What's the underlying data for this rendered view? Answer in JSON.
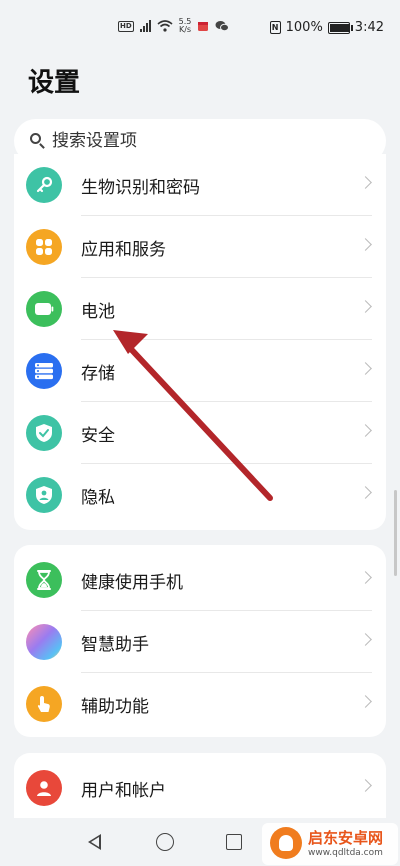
{
  "status_bar": {
    "speed_value": "5.5",
    "speed_unit": "K/s",
    "battery": "100%",
    "battery_level": 1.0,
    "time": "3:42",
    "hd": "HD",
    "nfc": "N"
  },
  "page": {
    "title": "设置"
  },
  "search": {
    "placeholder": "搜索设置项"
  },
  "groups": [
    {
      "items": [
        {
          "label": "生物识别和密码",
          "icon": "key-icon",
          "color": "#3ec3a5"
        },
        {
          "label": "应用和服务",
          "icon": "apps-grid-icon",
          "color": "#f5a623"
        },
        {
          "label": "电池",
          "icon": "battery-icon",
          "color": "#3cbf5c"
        },
        {
          "label": "存储",
          "icon": "storage-icon",
          "color": "#2a6ff0"
        },
        {
          "label": "安全",
          "icon": "shield-check-icon",
          "color": "#3ec3a5"
        },
        {
          "label": "隐私",
          "icon": "privacy-shield-icon",
          "color": "#3ec3a5"
        }
      ]
    },
    {
      "items": [
        {
          "label": "健康使用手机",
          "icon": "hourglass-icon",
          "color": "#3cbf5c"
        },
        {
          "label": "智慧助手",
          "icon": "assistant-orb-icon",
          "color": "#9a7cf0"
        },
        {
          "label": "辅助功能",
          "icon": "hand-tap-icon",
          "color": "#f5a623"
        }
      ]
    },
    {
      "items": [
        {
          "label": "用户和帐户",
          "icon": "user-icon",
          "color": "#e8483a"
        }
      ]
    }
  ],
  "watermark": {
    "title": "启东安卓网",
    "url": "www.qdltda.com"
  },
  "annotation": {
    "color": "#b3262a"
  }
}
